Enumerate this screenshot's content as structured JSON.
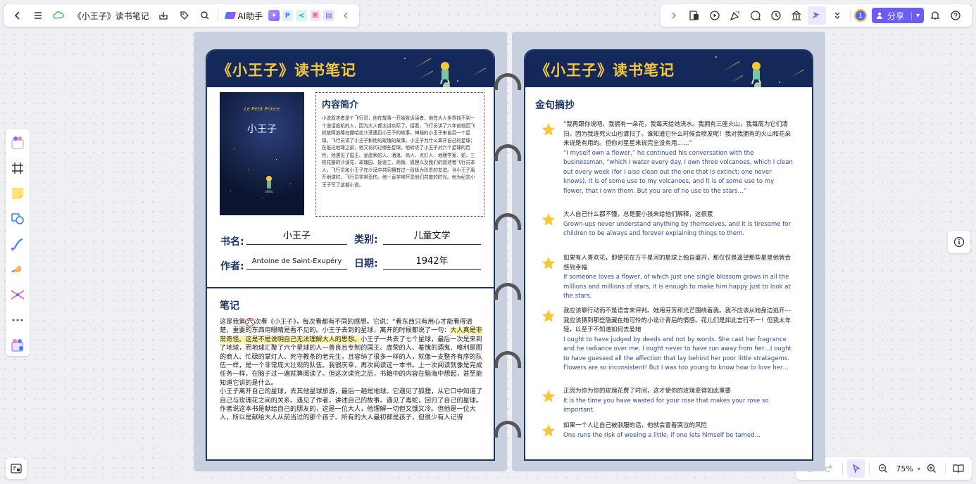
{
  "toolbar_left": {
    "doc_title": "《小王子》读书笔记",
    "ai_label": "AI助手"
  },
  "toolbar_right": {
    "avatar_count": "1",
    "share_label": "分享"
  },
  "zoom": {
    "value": "75%"
  },
  "left_page": {
    "title": "《小王子》读书笔记",
    "cover_title": "小王子",
    "cover_subtitle": "Le Petit Prince",
    "summary_heading": "内容简介",
    "summary_text": "小说叙述者是个飞行员，他在故事一开始告诉读者，他在大人世界找不到一个说话投机的人，因为大人都太讲实际了。接着，飞行员讲了六年前他因飞机故障迫降在撒哈拉沙漠遇见小王子的故事。神秘的小王子来自另一个星球。飞行员讲了小王子和他的玫瑰的故事。小王子为什么离开自己的星球；在抵达地球之前，他又访问过哪些星球。他转述了小王子对六个星球的历险，他遇见了国王、爱虚荣的人、酒鬼、商人、点灯人、地理学家、蛇、三枚花瓣的沙漠花、玫瑰园、扳道工、商贩、狐狸以及我们的叙述者飞行员本人。飞行员和小王子在沙漠中共同拥有过一段极为珍贵的友谊。当小王子离开地球时，飞行员非常悲伤。他一直非常怀念他们共度的时光。他为纪念小王子写了这部小说。",
    "fields": {
      "book_label": "书名:",
      "book_value": "小王子",
      "category_label": "类别:",
      "category_value": "儿童文学",
      "author_label": "作者:",
      "author_value": "Antoine de Saint-Exupéry",
      "date_label": "日期:",
      "date_value": "1942年"
    },
    "notes_heading": "笔记",
    "notes": {
      "p1_a": "这是我第",
      "p1_circled": "六",
      "p1_b": "次看《小王子》，每次看都有不同的感想。它说：“看东西只有用心才能看得清楚，重要的东西用眼睛是看不见的。小王子去到的星球，离开的时候都说了一句：",
      "p1_hl": "大人真是非常奇怪。这是不是说明自己无法理解大人的思想。",
      "p1_c": "小王子一共去了七个星球，最后一次是来到了地球，而地球汇聚了六个星球的人一善良且专制的国王、虚荣的人、羞愧的酒鬼、唯利是图的商人、忙碌的掌灯人、死守教条的老先生，且容纳了很多一样的人，就像一支整齐有序的队伍一样，是一个非常庞大壮观的队伍。我很庆幸，再次阅读这一本书。上一次阅读就像是完成任务一样，在脑子过一遍就算阅读了。但这次读完之后，书籍中的内容在脑海中想起，甚至能知道它讲的是什么。",
      "p2": "小王子离开自己的星球，去其他星球旅游，最后一趟是地球。它遇见了狐狸，从它口中知道了自己与玫瑰花之间的关系。遇见了作者，讲述自己的故事。遇见了毒蛇，回归了自己的星球。",
      "p3": "作者说这本书是献给自己的朋友的，这是一位大人，他理解一切但又饿又冷。但他是一位大人，所以是献给大人从前当过的那个孩子。所有的大人最初都是孩子，但很少有人记得"
    }
  },
  "right_page": {
    "title": "《小王子》读书笔记",
    "quotes_heading": "金句摘抄",
    "quotes": [
      {
        "cn": "“我再跟你说吧，我拥有一朵花，我每天给她浇水。我拥有三座火山，我每周为它们清扫。因为我连死火山也清扫了。谁知道它什么时候会喷发呢！我对我拥有的火山和花朵来说是有用的。但你对星星来说完全没有用……”",
        "en": "“I myself own a flower,” he continued his conversation with the businessman, “which I water every day. I own three volcanoes, which I clean out every week (for I also clean out the one that is extinct; one never knows). It is of some use to my volcanoes, and it is of some use to my flower, that I own them. But you are of no use to the stars…”"
      },
      {
        "cn": "大人自己什么都不懂，总是要小孩来给他们解释，这很累",
        "en": "Grown-ups never understand anything by themselves, and it is tiresome for children to be always and forever explaining things to them."
      },
      {
        "cn": "如果有人喜欢花，即便花在万千星河的星球上独自盛开，那仅仅是遥望那些星星他就会感到幸福",
        "en": "If someone loves a flower, of which just one single blossom grows in all the millions and millions of stars, it is enough to make him happy just to look at the stars."
      },
      {
        "cn": "我应该靠行动而不是语言来评判。她用芬芳和光芒围绕着我。我不应该从她身边逃开⋯我应该猜到那些隐藏在她可怜的小诡计背后的情感。花儿们是如此言行不一！但我太年轻，以至于不知道如何去爱她",
        "en": "I ought to have judged by deeds and not by words. She cast her fragrance and he radiance over me. I ought never to have run away from her…I ought to have guessed all the affection that lay behind her poor little stratagems. Flowers are so inconsistent! But I was too young to know how to love her…"
      },
      {
        "cn": "正因为你为你的玫瑰花费了时间，这才使你的玫瑰变得如此重要",
        "en": "It is the time you have wasted for your rose that makes your rose so important."
      },
      {
        "cn": "如果一个人让自己被驯服的话，他就会冒着哭泣的风险",
        "en": "One runs the risk of weeing a little, if one lets himself be tamed…"
      }
    ]
  }
}
